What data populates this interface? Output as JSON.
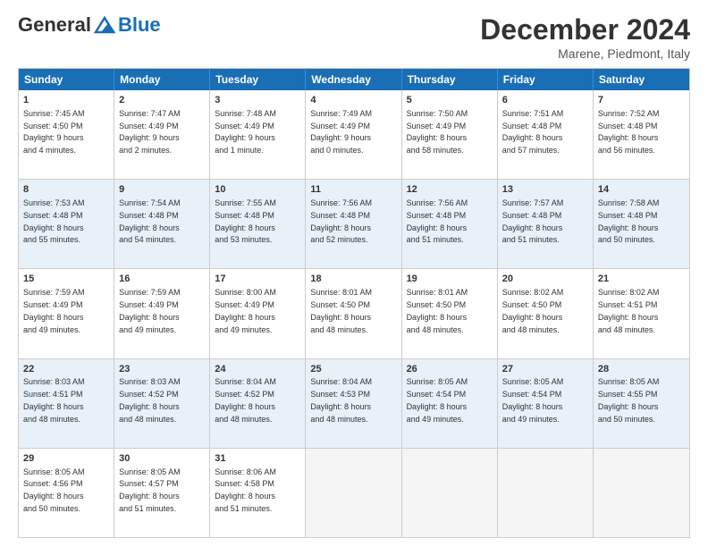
{
  "logo": {
    "general": "General",
    "blue": "Blue"
  },
  "title": "December 2024",
  "location": "Marene, Piedmont, Italy",
  "days_of_week": [
    "Sunday",
    "Monday",
    "Tuesday",
    "Wednesday",
    "Thursday",
    "Friday",
    "Saturday"
  ],
  "weeks": [
    [
      {
        "day": "1",
        "info": "Sunrise: 7:45 AM\nSunset: 4:50 PM\nDaylight: 9 hours\nand 4 minutes.",
        "empty": false
      },
      {
        "day": "2",
        "info": "Sunrise: 7:47 AM\nSunset: 4:49 PM\nDaylight: 9 hours\nand 2 minutes.",
        "empty": false
      },
      {
        "day": "3",
        "info": "Sunrise: 7:48 AM\nSunset: 4:49 PM\nDaylight: 9 hours\nand 1 minute.",
        "empty": false
      },
      {
        "day": "4",
        "info": "Sunrise: 7:49 AM\nSunset: 4:49 PM\nDaylight: 9 hours\nand 0 minutes.",
        "empty": false
      },
      {
        "day": "5",
        "info": "Sunrise: 7:50 AM\nSunset: 4:49 PM\nDaylight: 8 hours\nand 58 minutes.",
        "empty": false
      },
      {
        "day": "6",
        "info": "Sunrise: 7:51 AM\nSunset: 4:48 PM\nDaylight: 8 hours\nand 57 minutes.",
        "empty": false
      },
      {
        "day": "7",
        "info": "Sunrise: 7:52 AM\nSunset: 4:48 PM\nDaylight: 8 hours\nand 56 minutes.",
        "empty": false
      }
    ],
    [
      {
        "day": "8",
        "info": "Sunrise: 7:53 AM\nSunset: 4:48 PM\nDaylight: 8 hours\nand 55 minutes.",
        "empty": false
      },
      {
        "day": "9",
        "info": "Sunrise: 7:54 AM\nSunset: 4:48 PM\nDaylight: 8 hours\nand 54 minutes.",
        "empty": false
      },
      {
        "day": "10",
        "info": "Sunrise: 7:55 AM\nSunset: 4:48 PM\nDaylight: 8 hours\nand 53 minutes.",
        "empty": false
      },
      {
        "day": "11",
        "info": "Sunrise: 7:56 AM\nSunset: 4:48 PM\nDaylight: 8 hours\nand 52 minutes.",
        "empty": false
      },
      {
        "day": "12",
        "info": "Sunrise: 7:56 AM\nSunset: 4:48 PM\nDaylight: 8 hours\nand 51 minutes.",
        "empty": false
      },
      {
        "day": "13",
        "info": "Sunrise: 7:57 AM\nSunset: 4:48 PM\nDaylight: 8 hours\nand 51 minutes.",
        "empty": false
      },
      {
        "day": "14",
        "info": "Sunrise: 7:58 AM\nSunset: 4:48 PM\nDaylight: 8 hours\nand 50 minutes.",
        "empty": false
      }
    ],
    [
      {
        "day": "15",
        "info": "Sunrise: 7:59 AM\nSunset: 4:49 PM\nDaylight: 8 hours\nand 49 minutes.",
        "empty": false
      },
      {
        "day": "16",
        "info": "Sunrise: 7:59 AM\nSunset: 4:49 PM\nDaylight: 8 hours\nand 49 minutes.",
        "empty": false
      },
      {
        "day": "17",
        "info": "Sunrise: 8:00 AM\nSunset: 4:49 PM\nDaylight: 8 hours\nand 49 minutes.",
        "empty": false
      },
      {
        "day": "18",
        "info": "Sunrise: 8:01 AM\nSunset: 4:50 PM\nDaylight: 8 hours\nand 48 minutes.",
        "empty": false
      },
      {
        "day": "19",
        "info": "Sunrise: 8:01 AM\nSunset: 4:50 PM\nDaylight: 8 hours\nand 48 minutes.",
        "empty": false
      },
      {
        "day": "20",
        "info": "Sunrise: 8:02 AM\nSunset: 4:50 PM\nDaylight: 8 hours\nand 48 minutes.",
        "empty": false
      },
      {
        "day": "21",
        "info": "Sunrise: 8:02 AM\nSunset: 4:51 PM\nDaylight: 8 hours\nand 48 minutes.",
        "empty": false
      }
    ],
    [
      {
        "day": "22",
        "info": "Sunrise: 8:03 AM\nSunset: 4:51 PM\nDaylight: 8 hours\nand 48 minutes.",
        "empty": false
      },
      {
        "day": "23",
        "info": "Sunrise: 8:03 AM\nSunset: 4:52 PM\nDaylight: 8 hours\nand 48 minutes.",
        "empty": false
      },
      {
        "day": "24",
        "info": "Sunrise: 8:04 AM\nSunset: 4:52 PM\nDaylight: 8 hours\nand 48 minutes.",
        "empty": false
      },
      {
        "day": "25",
        "info": "Sunrise: 8:04 AM\nSunset: 4:53 PM\nDaylight: 8 hours\nand 48 minutes.",
        "empty": false
      },
      {
        "day": "26",
        "info": "Sunrise: 8:05 AM\nSunset: 4:54 PM\nDaylight: 8 hours\nand 49 minutes.",
        "empty": false
      },
      {
        "day": "27",
        "info": "Sunrise: 8:05 AM\nSunset: 4:54 PM\nDaylight: 8 hours\nand 49 minutes.",
        "empty": false
      },
      {
        "day": "28",
        "info": "Sunrise: 8:05 AM\nSunset: 4:55 PM\nDaylight: 8 hours\nand 50 minutes.",
        "empty": false
      }
    ],
    [
      {
        "day": "29",
        "info": "Sunrise: 8:05 AM\nSunset: 4:56 PM\nDaylight: 8 hours\nand 50 minutes.",
        "empty": false
      },
      {
        "day": "30",
        "info": "Sunrise: 8:05 AM\nSunset: 4:57 PM\nDaylight: 8 hours\nand 51 minutes.",
        "empty": false
      },
      {
        "day": "31",
        "info": "Sunrise: 8:06 AM\nSunset: 4:58 PM\nDaylight: 8 hours\nand 51 minutes.",
        "empty": false
      },
      {
        "day": "",
        "info": "",
        "empty": true
      },
      {
        "day": "",
        "info": "",
        "empty": true
      },
      {
        "day": "",
        "info": "",
        "empty": true
      },
      {
        "day": "",
        "info": "",
        "empty": true
      }
    ]
  ]
}
